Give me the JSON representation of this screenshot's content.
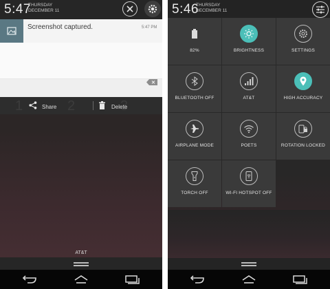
{
  "left": {
    "status": {
      "time": "5:47",
      "day": "THURSDAY",
      "date": "DECEMBER 11"
    },
    "notification": {
      "title": "Screenshot captured.",
      "time": "5:47 PM"
    },
    "dial_digits": [
      "1",
      "2",
      "3"
    ],
    "actions": {
      "share": "Share",
      "delete": "Delete"
    },
    "carrier": "AT&T"
  },
  "right": {
    "status": {
      "time": "5:46",
      "day": "THURSDAY",
      "date": "DECEMBER 11"
    },
    "tiles": [
      {
        "label": "82%",
        "icon": "battery-icon",
        "active": false
      },
      {
        "label": "BRIGHTNESS",
        "icon": "brightness-icon",
        "active": true
      },
      {
        "label": "SETTINGS",
        "icon": "settings-gear-icon",
        "active": false
      },
      {
        "label": "BLUETOOTH OFF",
        "icon": "bluetooth-icon",
        "active": false
      },
      {
        "label": "AT&T",
        "icon": "signal-icon",
        "active": false
      },
      {
        "label": "HIGH ACCURACY",
        "icon": "location-pin-icon",
        "active": true
      },
      {
        "label": "AIRPLANE MODE",
        "icon": "airplane-icon",
        "active": false
      },
      {
        "label": "POETS",
        "icon": "wifi-icon",
        "active": false
      },
      {
        "label": "ROTATION LOCKED",
        "icon": "rotation-lock-icon",
        "active": false
      },
      {
        "label": "TORCH OFF",
        "icon": "torch-icon",
        "active": false
      },
      {
        "label": "WI-FI HOTSPOT OFF",
        "icon": "hotspot-icon",
        "active": false
      }
    ]
  },
  "colors": {
    "accent": "#4bbfb8",
    "tile": "#3a3a3a"
  }
}
